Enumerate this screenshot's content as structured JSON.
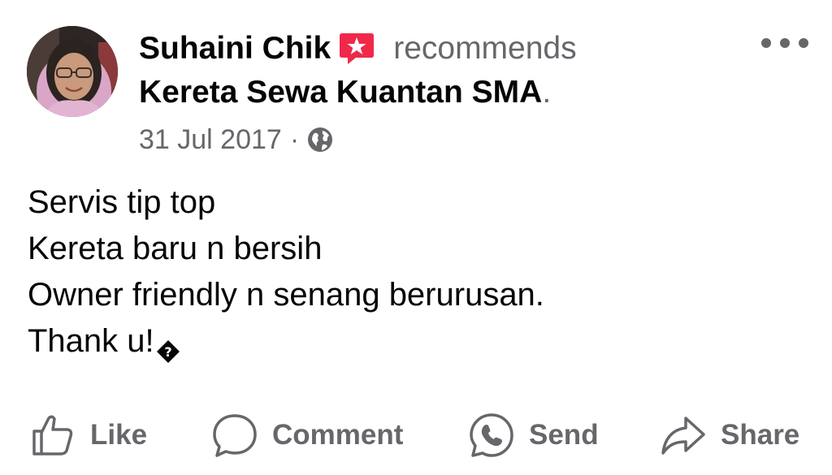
{
  "header": {
    "author_name": "Suhaini Chik",
    "recommend_badge_icon": "recommendation-badge-icon",
    "recommends_text": "recommends",
    "page_name": "Kereta Sewa Kuantan SMA",
    "page_period": ".",
    "date": "31 Jul 2017",
    "separator": "·",
    "privacy_icon": "globe-icon",
    "more_icon": "more-options-icon"
  },
  "post": {
    "lines": [
      "Servis tip top",
      "Kereta baru n bersih",
      "Owner friendly n senang berurusan.",
      "Thank u!"
    ],
    "trailing_glyph_icon": "unsupported-emoji-glyph-icon"
  },
  "actions": [
    {
      "label": "Like",
      "icon": "like-thumb-icon"
    },
    {
      "label": "Comment",
      "icon": "comment-bubble-icon"
    },
    {
      "label": "Send",
      "icon": "messenger-send-icon"
    },
    {
      "label": "Share",
      "icon": "share-arrow-icon"
    }
  ],
  "colors": {
    "primary_text": "#050505",
    "secondary_text": "#65676b",
    "badge_red": "#f02849",
    "background": "#ffffff"
  }
}
